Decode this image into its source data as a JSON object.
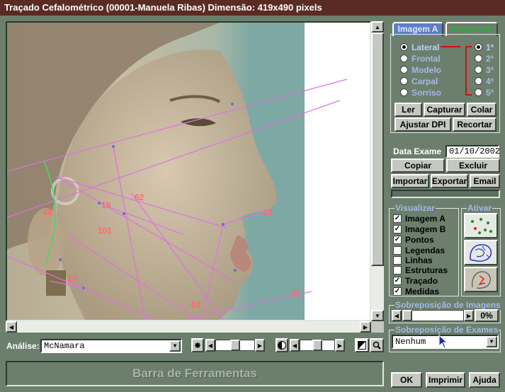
{
  "window": {
    "title": "Traçado Cefalométrico (00001-Manuela Ribas)  Dimensão: 419x490 pixels"
  },
  "viewer": {
    "annotations": [
      {
        "id": "angle_49",
        "text": "49°"
      },
      {
        "id": "n_19",
        "text": "19"
      },
      {
        "id": "n_62a",
        "text": "62"
      },
      {
        "id": "n_101",
        "text": "101"
      },
      {
        "id": "n_21",
        "text": "21"
      },
      {
        "id": "n_13",
        "text": "13"
      },
      {
        "id": "n_62b",
        "text": "62"
      },
      {
        "id": "n_42",
        "text": "42"
      }
    ]
  },
  "image_tabs": {
    "tab_a": "Imagem A",
    "tab_b": "Imagem B",
    "active": "Imagem A"
  },
  "view_types": {
    "items": [
      "Lateral",
      "Frontal",
      "Modelo",
      "Carpal",
      "Sorriso"
    ],
    "selected": "Lateral"
  },
  "image_slots": {
    "items": [
      "1ª",
      "2ª",
      "3ª",
      "4ª",
      "5ª"
    ],
    "selected": "1ª"
  },
  "image_buttons": {
    "ler": "Ler",
    "capturar": "Capturar",
    "colar": "Colar",
    "ajustar_dpi": "Ajustar DPI",
    "recortar": "Recortar"
  },
  "exam": {
    "date_label": "Data Exame",
    "date_value": "01/10/2002",
    "copiar": "Copiar",
    "excluir": "Excluir",
    "importar": "Importar",
    "exportar": "Exportar",
    "email": "Email"
  },
  "visualizar": {
    "title": "Visualizar",
    "items": [
      {
        "label": "Imagem A",
        "checked": true
      },
      {
        "label": "Imagem B",
        "checked": true
      },
      {
        "label": "Pontos",
        "checked": true
      },
      {
        "label": "Legendas",
        "checked": false
      },
      {
        "label": "Linhas",
        "checked": false
      },
      {
        "label": "Estruturas",
        "checked": false
      },
      {
        "label": "Traçado",
        "checked": true
      },
      {
        "label": "Medidas",
        "checked": true
      }
    ]
  },
  "ativar": {
    "title": "Ativar",
    "icons": [
      "points-tool-icon",
      "structures-tool-icon",
      "tracing-tool-icon"
    ]
  },
  "sobreposicao_imagens": {
    "title": "Sobreposição de Imagens",
    "value": "0%",
    "level": 0
  },
  "sobreposicao_exames": {
    "title": "Sobreposição de Exames",
    "value": "Nenhum"
  },
  "analise": {
    "label": "Análise:",
    "value": "McNamara"
  },
  "brightness": {
    "level": 0.5
  },
  "contrast": {
    "level": 0.5
  },
  "statusbar": {
    "text": "Barra de Ferramentas"
  },
  "footer": {
    "ok": "OK",
    "imprimir": "Imprimir",
    "ajuda": "Ajuda"
  },
  "colors": {
    "title_bg": "#5a2b22",
    "panel_bg": "#6c7f6d",
    "radio_label": "#a5b8e8",
    "tab_b_label": "#2faa3f",
    "bracket": "#cc1111",
    "measurement_lines": "#e070e0",
    "measurement_text": "#ff6a6a"
  }
}
